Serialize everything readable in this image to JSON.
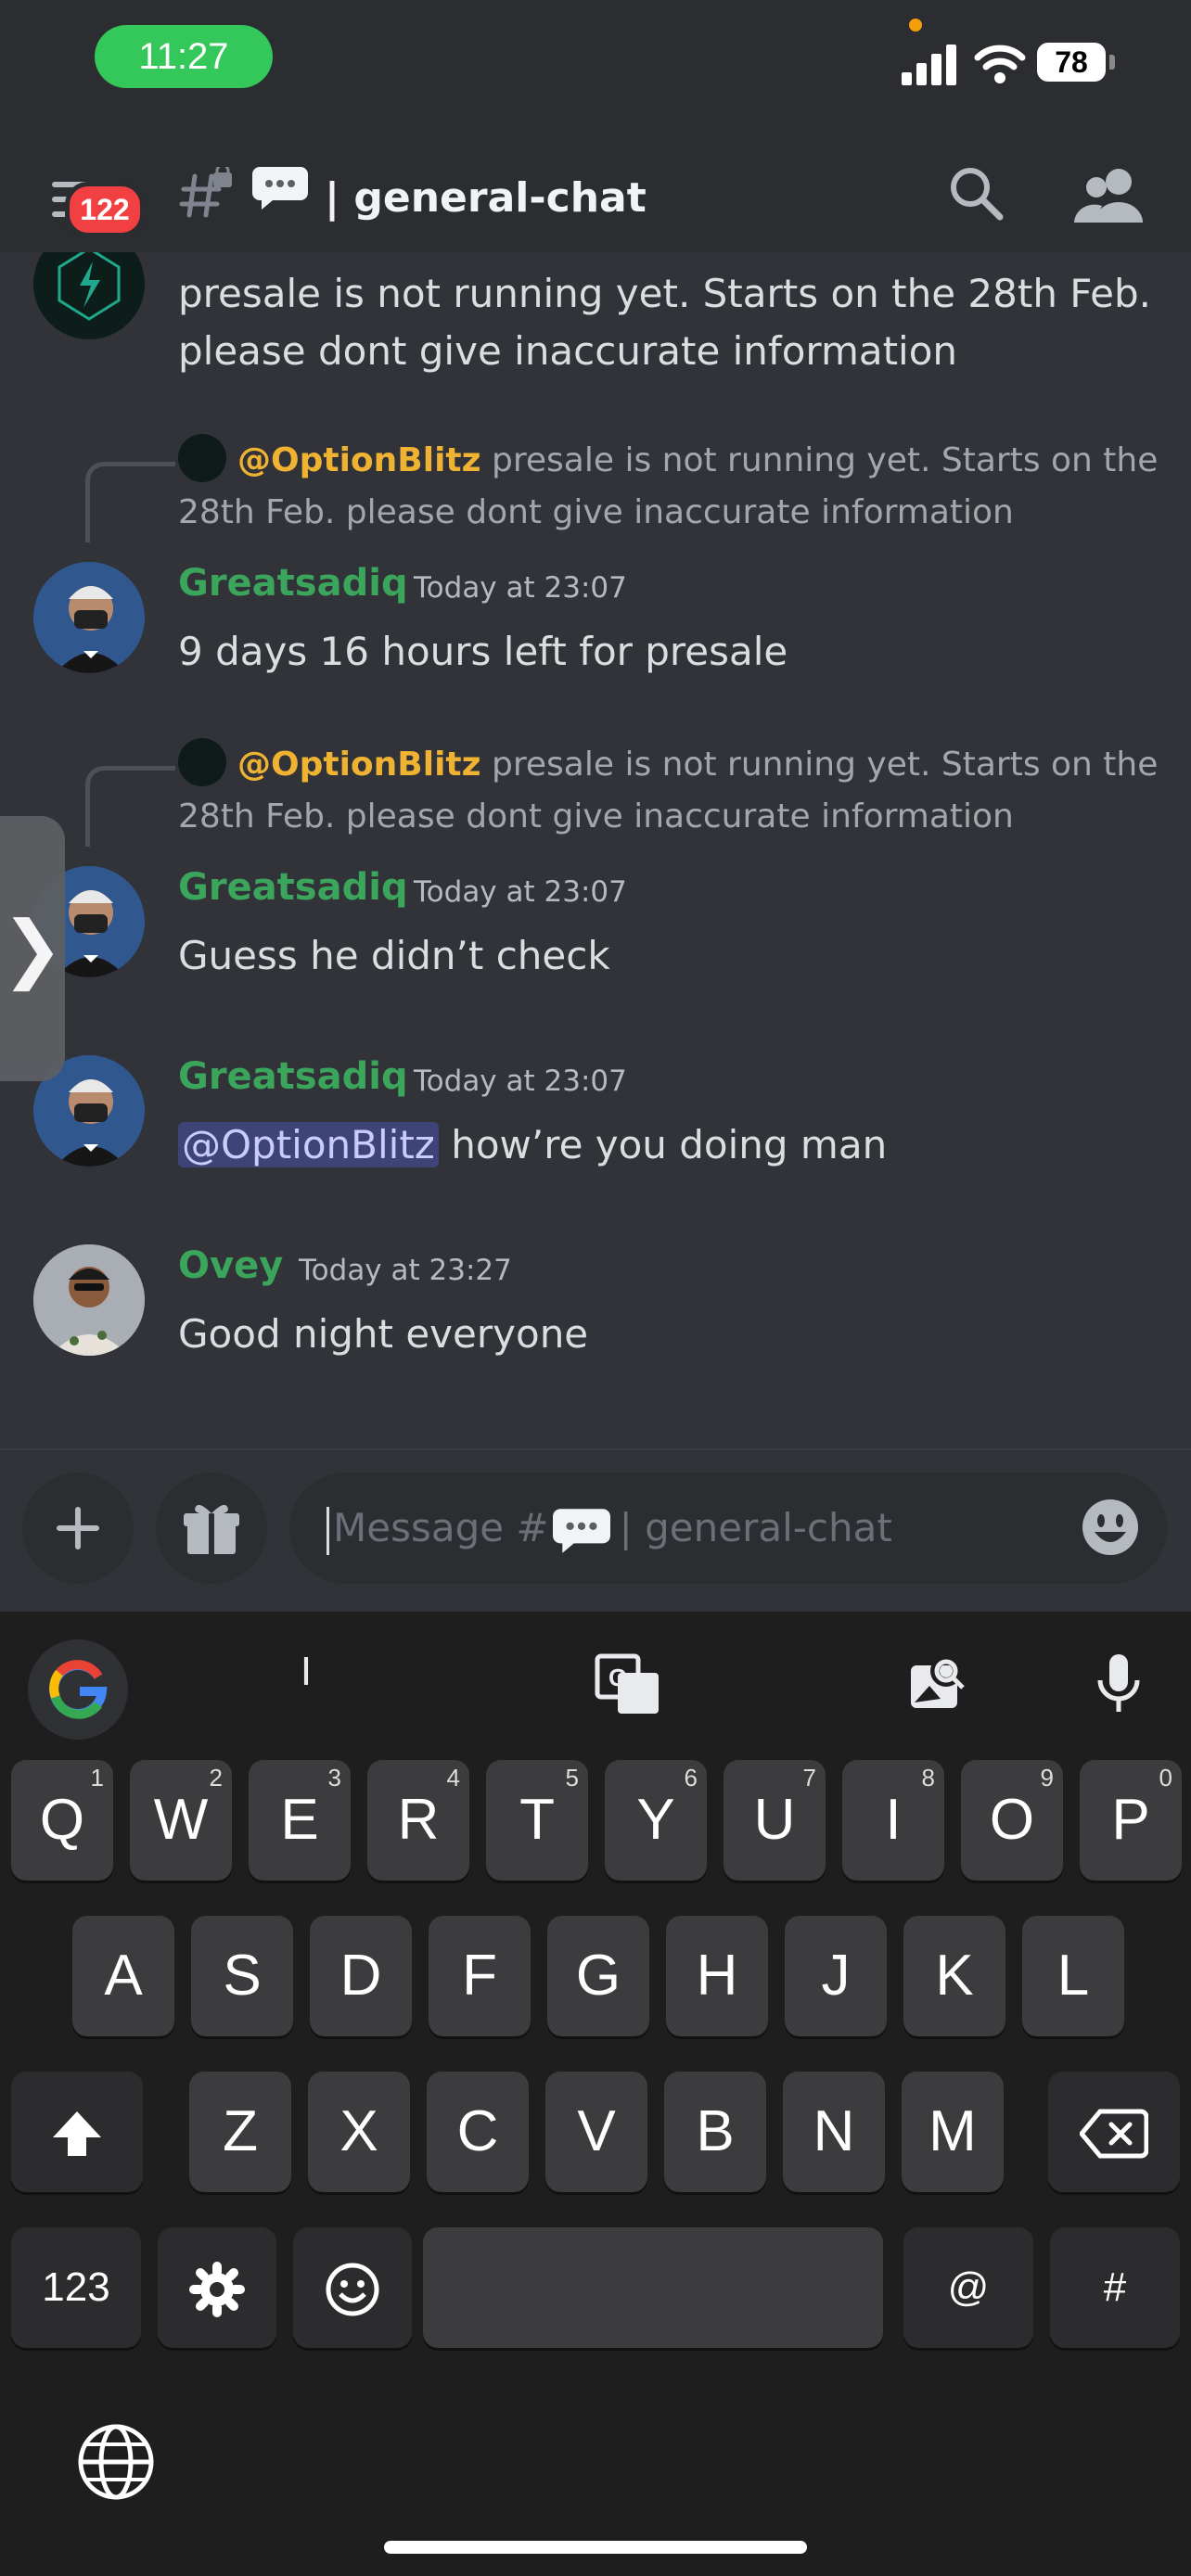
{
  "status_bar": {
    "time": "11:27",
    "battery": "78"
  },
  "header": {
    "unread_badge": "122",
    "channel_name": "| general-chat"
  },
  "messages": [
    {
      "id": "m0",
      "text_line1": "presale is not running yet. Starts on the 28th Feb.",
      "text_line2": "please dont give inaccurate information"
    },
    {
      "id": "m1",
      "reply_author": "@OptionBlitz",
      "reply_line1": "presale is not running yet. Starts on the",
      "reply_line2": "28th Feb. please dont give inaccurate information",
      "author": "Greatsadiq",
      "timestamp": "Today at 23:07",
      "text": "9 days 16 hours left for presale"
    },
    {
      "id": "m2",
      "reply_author": "@OptionBlitz",
      "reply_line1": "presale is not running yet. Starts on the",
      "reply_line2": "28th Feb. please dont give inaccurate information",
      "author": "Greatsadiq",
      "timestamp": "Today at 23:07",
      "text": "Guess he didn’t check"
    },
    {
      "id": "m3",
      "author": "Greatsadiq",
      "timestamp": "Today at 23:07",
      "mention": "@OptionBlitz",
      "text": "how’re you doing man"
    },
    {
      "id": "m4",
      "author": "Ovey",
      "timestamp": "Today at 23:27",
      "text": "Good night everyone"
    }
  ],
  "composer": {
    "placeholder_prefix": "Message #",
    "placeholder_suffix": "| general-chat"
  },
  "keyboard": {
    "suggestion": "I",
    "row1": [
      [
        "Q",
        "1"
      ],
      [
        "W",
        "2"
      ],
      [
        "E",
        "3"
      ],
      [
        "R",
        "4"
      ],
      [
        "T",
        "5"
      ],
      [
        "Y",
        "6"
      ],
      [
        "U",
        "7"
      ],
      [
        "I",
        "8"
      ],
      [
        "O",
        "9"
      ],
      [
        "P",
        "0"
      ]
    ],
    "row2": [
      "A",
      "S",
      "D",
      "F",
      "G",
      "H",
      "J",
      "K",
      "L"
    ],
    "row3": [
      "Z",
      "X",
      "C",
      "V",
      "B",
      "N",
      "M"
    ],
    "numbers_key": "123",
    "at_key": "@",
    "hash_key": "#"
  },
  "colors": {
    "background": "#313338",
    "header": "#2b2d31",
    "username_green": "#3ba55c",
    "reply_author_yellow": "#f0b232",
    "badge_red": "#f23f42"
  },
  "icons": [
    "menu-icon",
    "hash-lock-icon",
    "speech-bubble-icon",
    "search-icon",
    "members-icon",
    "plus-icon",
    "gift-icon",
    "emoji-icon",
    "google-icon",
    "translate-icon",
    "image-search-icon",
    "microphone-icon",
    "shift-icon",
    "backspace-icon",
    "settings-icon",
    "smiley-icon",
    "globe-icon"
  ]
}
